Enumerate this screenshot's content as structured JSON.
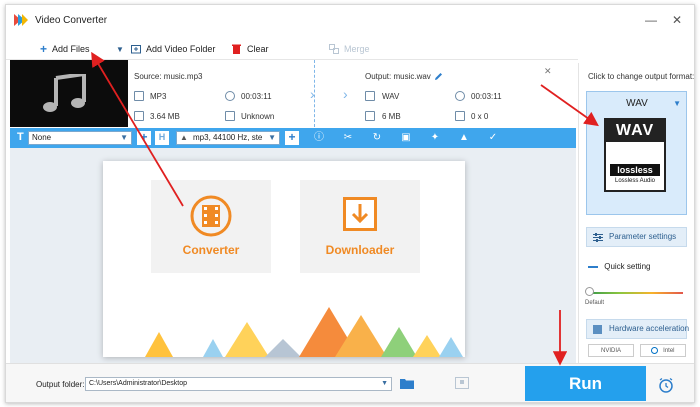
{
  "window": {
    "title": "Video Converter"
  },
  "toolbar": {
    "add_files": "Add Files",
    "add_video_folder": "Add Video Folder",
    "clear": "Clear",
    "merge": "Merge"
  },
  "file_item": {
    "source_label": "Source: music.mp3",
    "output_label": "Output: music.wav",
    "source": {
      "format": "MP3",
      "duration": "00:03:11",
      "size": "3.64 MB",
      "resolution": "Unknown"
    },
    "output": {
      "format": "WAV",
      "duration": "00:03:11",
      "size": "6 MB",
      "resolution": "0 x 0"
    }
  },
  "edit_bar": {
    "subtitle": "None",
    "audio_track": "mp3, 44100 Hz, ste"
  },
  "home": {
    "converter": "Converter",
    "downloader": "Downloader"
  },
  "right_panel": {
    "hint": "Click to change output format:",
    "format_name": "WAV",
    "format_icon_text": "WAV",
    "format_icon_badge": "lossless",
    "format_icon_caption": "Lossless Audio",
    "parameter_settings": "Parameter settings",
    "quick_setting": "Quick setting",
    "slider_default": "Default",
    "hardware_acceleration": "Hardware acceleration",
    "vendor_nvidia": "NVIDIA",
    "vendor_intel": "Intel"
  },
  "bottom": {
    "output_folder_label": "Output folder:",
    "output_folder_path": "C:\\Users\\Administrator\\Desktop",
    "run": "Run"
  },
  "colors": {
    "accent_blue": "#24a0ed",
    "brand_orange": "#f08a24",
    "annotation_red": "#e02020"
  }
}
